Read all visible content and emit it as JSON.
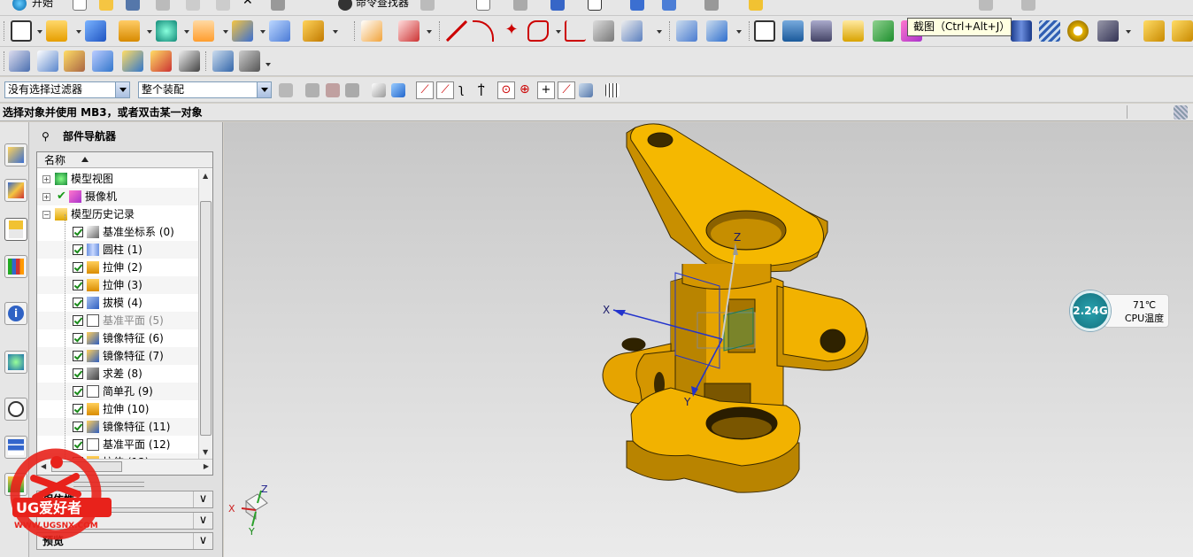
{
  "menu": {
    "start_label": "开始",
    "command_finder_label": "命令查找器"
  },
  "tooltip": {
    "text": "截图（Ctrl+Alt+J）"
  },
  "selection_bar": {
    "filter_value": "没有选择过滤器",
    "scope_value": "整个装配"
  },
  "cue_line": {
    "text": "选择对象并使用 MB3，或者双击某一对象"
  },
  "navigator": {
    "title": "部件导航器",
    "column_header": "名称",
    "nodes": [
      {
        "label": "模型视图"
      },
      {
        "label": "摄像机"
      },
      {
        "label": "模型历史记录"
      }
    ],
    "features": [
      {
        "label": "基准坐标系 (0)"
      },
      {
        "label": "圆柱 (1)"
      },
      {
        "label": "拉伸 (2)"
      },
      {
        "label": "拉伸 (3)"
      },
      {
        "label": "拔模 (4)"
      },
      {
        "label": "基准平面 (5)"
      },
      {
        "label": "镜像特征 (6)"
      },
      {
        "label": "镜像特征 (7)"
      },
      {
        "label": "求差 (8)"
      },
      {
        "label": "简单孔 (9)"
      },
      {
        "label": "拉伸 (10)"
      },
      {
        "label": "镜像特征 (11)"
      },
      {
        "label": "基准平面 (12)"
      },
      {
        "label": "拉伸 (13)"
      }
    ],
    "panels": [
      {
        "label": "相依性"
      },
      {
        "label": ""
      },
      {
        "label": "预览"
      }
    ]
  },
  "viewport": {
    "axis_labels": {
      "x": "X",
      "y": "Y",
      "z": "Z"
    },
    "triad_labels": {
      "x": "X",
      "y": "Y",
      "z": "Z"
    }
  },
  "cpu_widget": {
    "usage": "2.24G",
    "temperature": "71℃",
    "label": "CPU温度"
  },
  "watermark": {
    "brand": "UG爱好者",
    "url": "WWW.UGSNX.COM"
  },
  "colors": {
    "part_yellow": "#f2b200",
    "part_shadow": "#b98400",
    "toolbar_bg": "#e6e6e6",
    "cpu_teal": "#1a8a98",
    "watermark_red": "#e8221b"
  }
}
